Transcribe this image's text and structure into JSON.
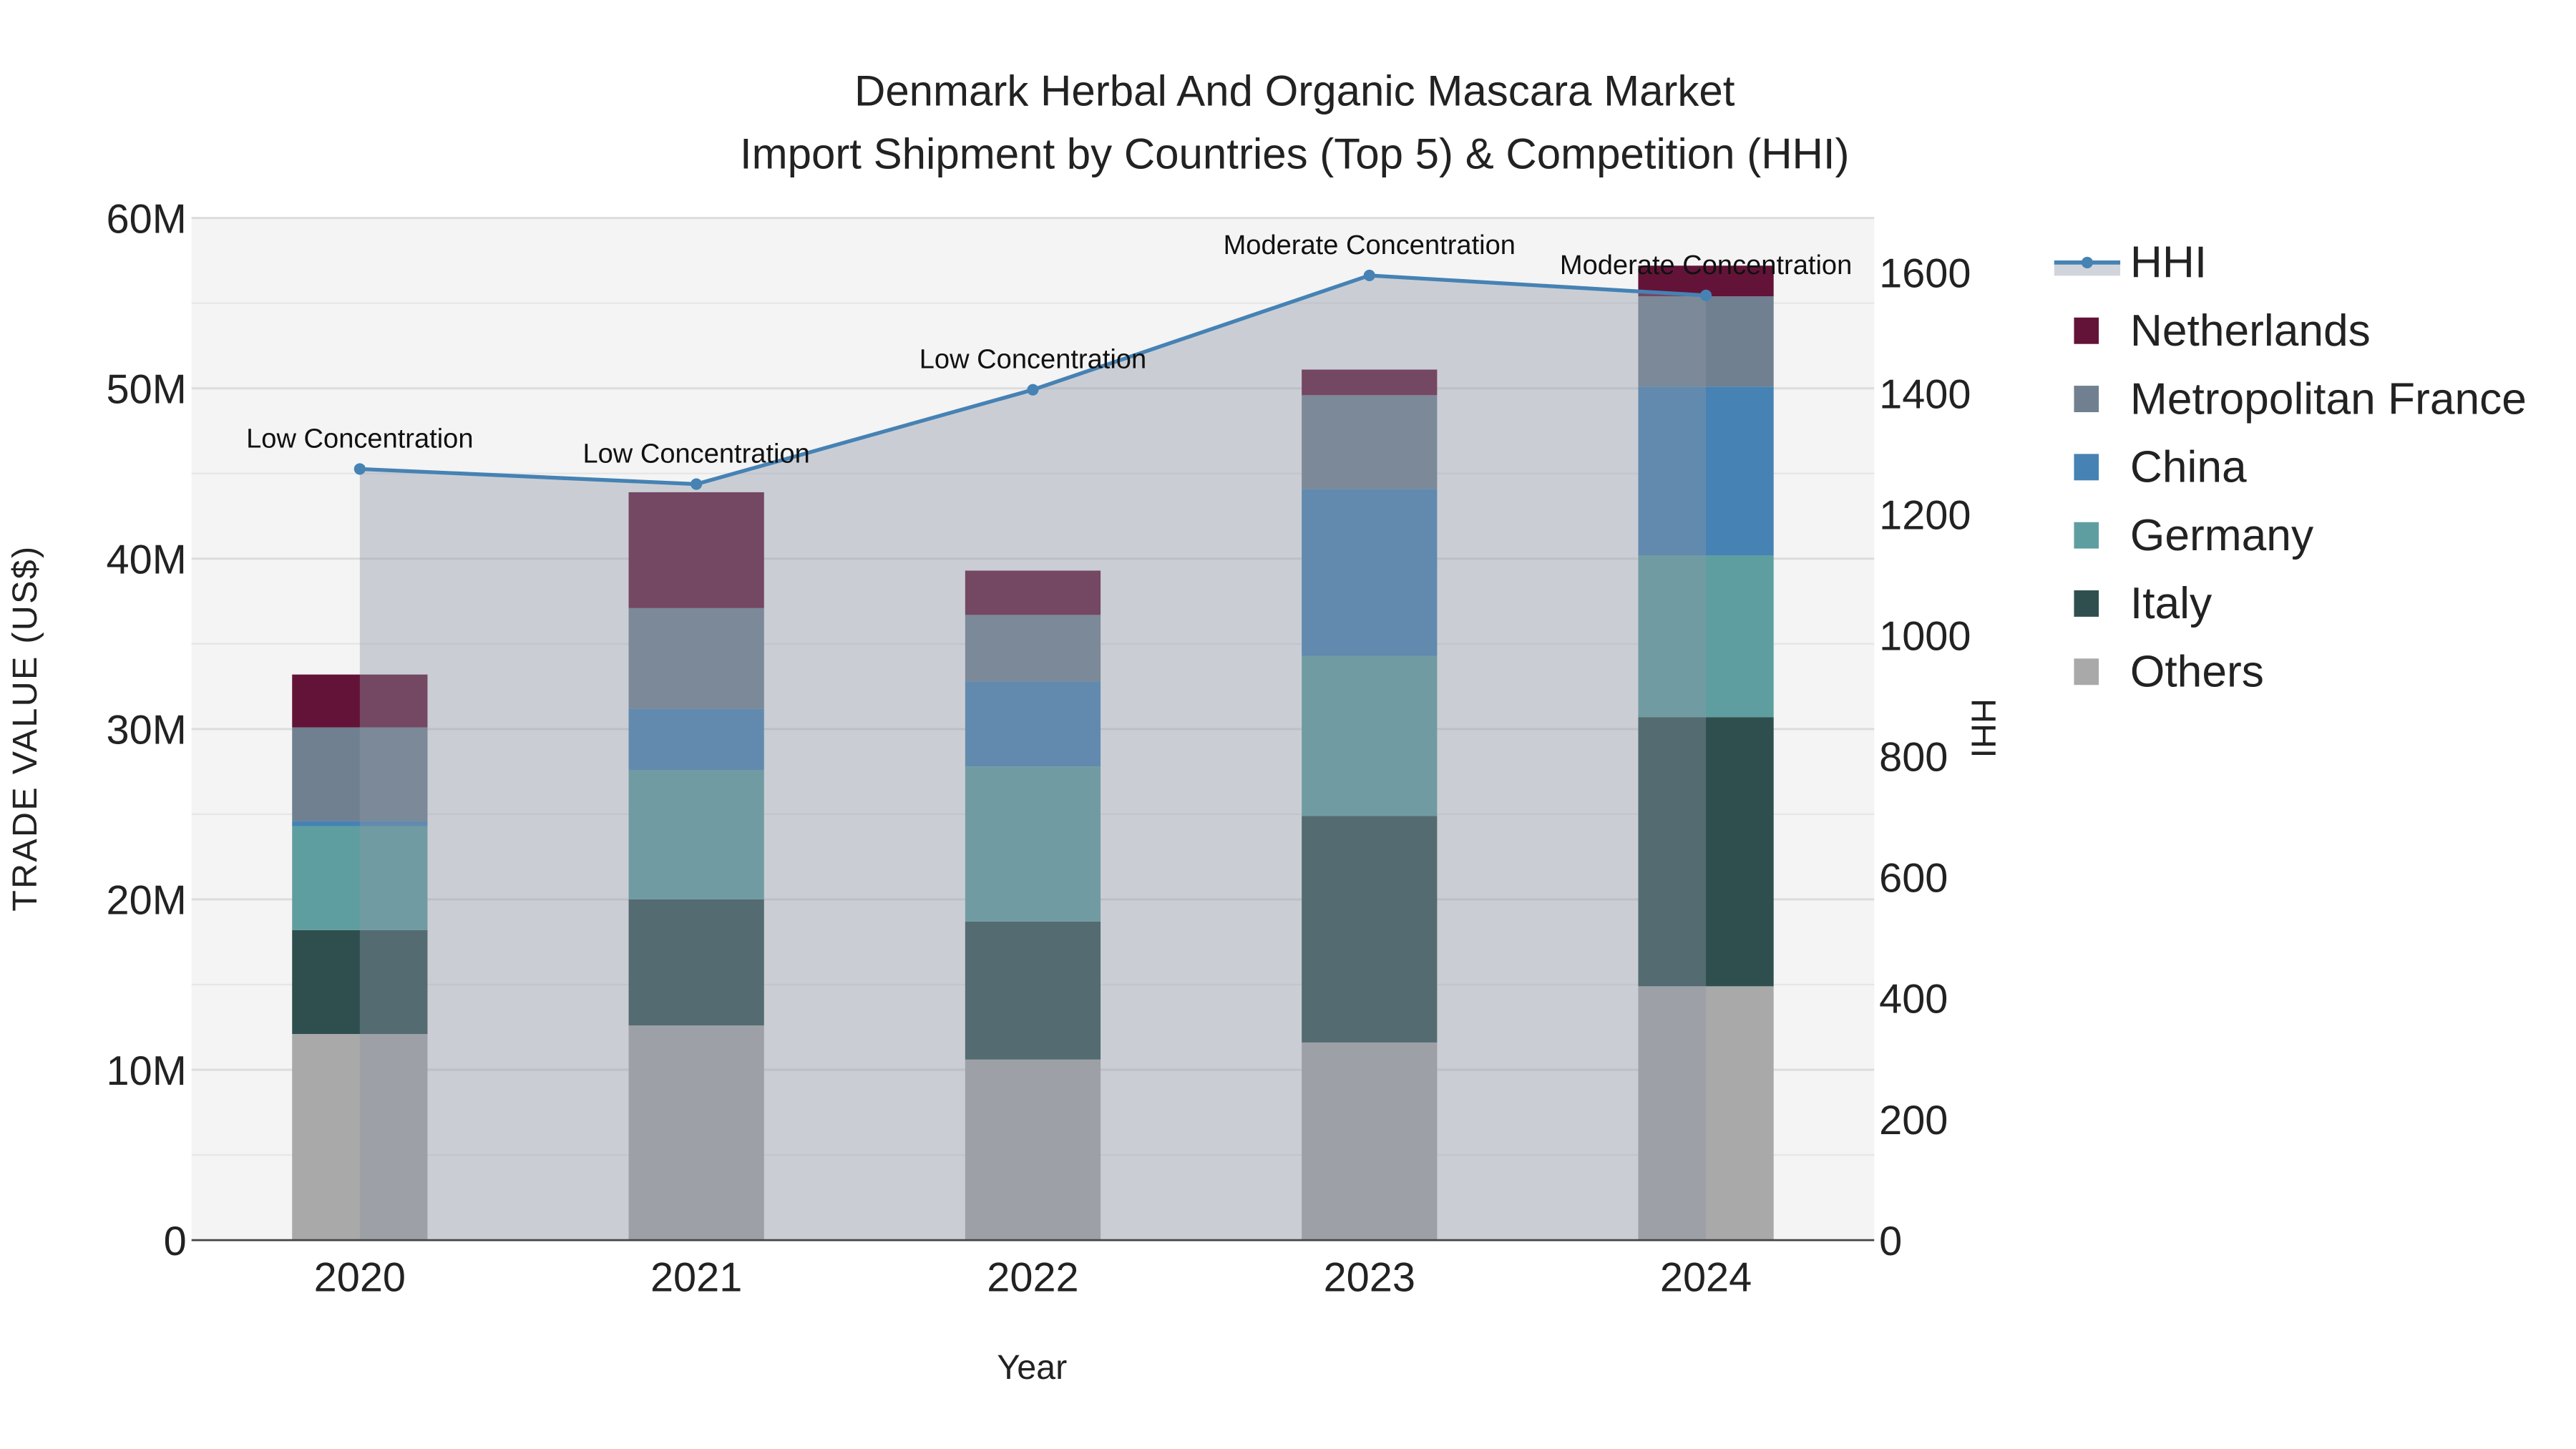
{
  "chart_data": {
    "type": "bar",
    "stacked": true,
    "title": "Denmark Herbal And Organic Mascara Market",
    "subtitle": "Import Shipment by Countries (Top 5) & Competition (HHI)",
    "xlabel": "Year",
    "ylabel": "TRADE VALUE (US$)",
    "y2label": "HHI",
    "categories": [
      "2020",
      "2021",
      "2022",
      "2023",
      "2024"
    ],
    "ylim": [
      0,
      60000000
    ],
    "y2lim": [
      0,
      1690
    ],
    "yticks": [
      0,
      10000000,
      20000000,
      30000000,
      40000000,
      50000000,
      60000000
    ],
    "ytick_labels": [
      "0",
      "10M",
      "20M",
      "30M",
      "40M",
      "50M",
      "60M"
    ],
    "y2ticks": [
      0,
      200,
      400,
      600,
      800,
      1000,
      1200,
      1400,
      1600
    ],
    "y2tick_labels": [
      "0",
      "200",
      "400",
      "600",
      "800",
      "1000",
      "1200",
      "1400",
      "1600"
    ],
    "grid": true,
    "legend_position": "right",
    "series": [
      {
        "name": "Others",
        "color": "#a9a9a9",
        "values": [
          12100000,
          12600000,
          10600000,
          11600000,
          14900000
        ]
      },
      {
        "name": "Italy",
        "color": "#2f4f4f",
        "values": [
          6100000,
          7400000,
          8100000,
          13300000,
          15800000
        ]
      },
      {
        "name": "Germany",
        "color": "#5f9ea0",
        "values": [
          6100000,
          7600000,
          9100000,
          9400000,
          9500000
        ]
      },
      {
        "name": "China",
        "color": "#4682b4",
        "values": [
          300000,
          3600000,
          5000000,
          9800000,
          9900000
        ]
      },
      {
        "name": "Metropolitan France",
        "color": "#708090",
        "values": [
          5500000,
          5900000,
          3900000,
          5500000,
          5300000
        ]
      },
      {
        "name": "Netherlands",
        "color": "#641338",
        "values": [
          3100000,
          6800000,
          2600000,
          1500000,
          1800000
        ]
      }
    ],
    "line": {
      "name": "HHI",
      "color": "#4682b4",
      "values": [
        1275,
        1250,
        1406,
        1595,
        1562
      ],
      "annotations": [
        "Low Concentration",
        "Low Concentration",
        "Low Concentration",
        "Moderate Concentration",
        "Moderate Concentration"
      ]
    },
    "legend_order": [
      "HHI",
      "Netherlands",
      "Metropolitan France",
      "China",
      "Germany",
      "Italy",
      "Others"
    ]
  }
}
